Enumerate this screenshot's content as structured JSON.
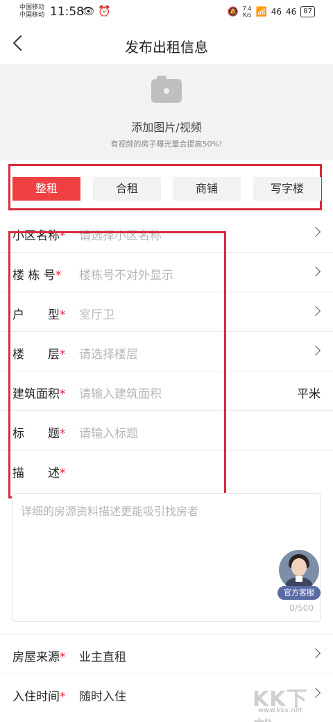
{
  "status_bar": {
    "carrier_1": "中国移动",
    "carrier_2": "中国移动",
    "time": "11:58",
    "net_speed_value": "7.4",
    "net_speed_unit": "K/s",
    "signal_1": "46",
    "signal_2": "46",
    "battery": "87"
  },
  "nav": {
    "title": "发布出租信息"
  },
  "media": {
    "title": "添加图片/视频",
    "subtitle": "有视频的房子曝光量会提高50%!"
  },
  "tabs": [
    {
      "label": "整租",
      "active": true
    },
    {
      "label": "合租",
      "active": false
    },
    {
      "label": "商铺",
      "active": false
    },
    {
      "label": "写字楼",
      "active": false
    }
  ],
  "form": {
    "rows": [
      {
        "label": "小区名称",
        "placeholder": "请选择小区名称",
        "value": "",
        "unit": "",
        "arrow": true
      },
      {
        "label": "楼 栋 号",
        "placeholder": "楼栋号不对外显示",
        "value": "",
        "unit": "",
        "arrow": true
      },
      {
        "label": "户　　型",
        "placeholder": "室厅卫",
        "value": "",
        "unit": "",
        "arrow": true
      },
      {
        "label": "楼　　层",
        "placeholder": "请选择楼层",
        "value": "",
        "unit": "",
        "arrow": true
      },
      {
        "label": "建筑面积",
        "placeholder": "请输入建筑面积",
        "value": "",
        "unit": "平米",
        "arrow": false
      },
      {
        "label": "标　　题",
        "placeholder": "请输入标题",
        "value": "",
        "unit": "",
        "arrow": false
      },
      {
        "label": "描　　述",
        "placeholder": "",
        "value": "",
        "unit": "",
        "arrow": false
      }
    ],
    "required_mark": "*",
    "description_placeholder": "详细的房源资料描述更能吸引找房者",
    "description_counter": "0/500",
    "service_label": "官方客服",
    "bottom_rows": [
      {
        "label": "房屋来源",
        "value": "业主直租",
        "arrow": true
      },
      {
        "label": "入住时间",
        "value": "随时入住",
        "arrow": true
      }
    ]
  },
  "watermark": {
    "main": "KK下载",
    "url": "www.kkx.net"
  },
  "colors": {
    "accent": "#f04142",
    "highlight_box": "#d62b3a",
    "required": "#e5262e",
    "placeholder": "#b5b5b5"
  }
}
